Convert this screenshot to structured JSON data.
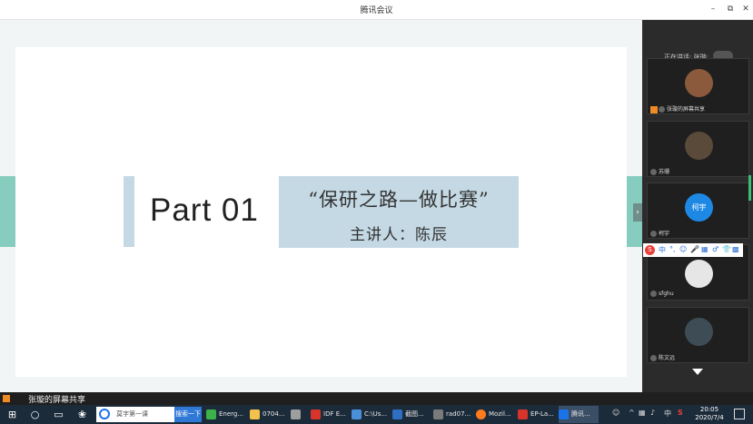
{
  "window": {
    "title": "腾讯会议",
    "minimize": "–",
    "restore": "⧉",
    "close": "✕"
  },
  "slide": {
    "part": "Part 01",
    "title": "“保研之路—做比赛”",
    "subtitle": "主讲人：陈辰"
  },
  "panel": {
    "speaking": "正在讲话: 张璇;",
    "participants": [
      {
        "name": "张璇的屏幕共享",
        "avatar_color": "#8b5a3c"
      },
      {
        "name": "苏珊",
        "avatar_color": "#5a4a3a"
      },
      {
        "name": "柯宇",
        "avatar_color": "#1e88e5",
        "initials": "柯宇"
      },
      {
        "name": "sfghu",
        "avatar_color": "#e6e6e6"
      },
      {
        "name": "陈文远",
        "avatar_color": "#3d4c55"
      }
    ],
    "ime_items": [
      "中",
      "°,",
      "☺",
      "🎤",
      "▦",
      "♂",
      "👕",
      "▩"
    ]
  },
  "share_strip": {
    "label": "张璇的屏幕共享"
  },
  "taskbar": {
    "search_text": "莫字第一课",
    "search_button": "搜索一下",
    "tasks": [
      {
        "label": "Energ...",
        "color": "#3cb34a"
      },
      {
        "label": "0704...",
        "color": "#f2c14e"
      },
      {
        "label": "",
        "color": "#9e9e9e",
        "icon": "gear"
      },
      {
        "label": "IDF E...",
        "color": "#d9342b"
      },
      {
        "label": "C:\\Us...",
        "color": "#4a90d9"
      },
      {
        "label": "截图...",
        "color": "#2f6fc2"
      },
      {
        "label": "rad07...",
        "color": "#7a7a7a"
      },
      {
        "label": "Mozil...",
        "color": "#ff7b1c"
      },
      {
        "label": "EP-La...",
        "color": "#d9342b"
      },
      {
        "label": "腾讯...",
        "color": "#1a73e8"
      }
    ],
    "tray_lang": "中",
    "tray_antivirus": "S",
    "time": "20:05",
    "date": "2020/7/4"
  }
}
